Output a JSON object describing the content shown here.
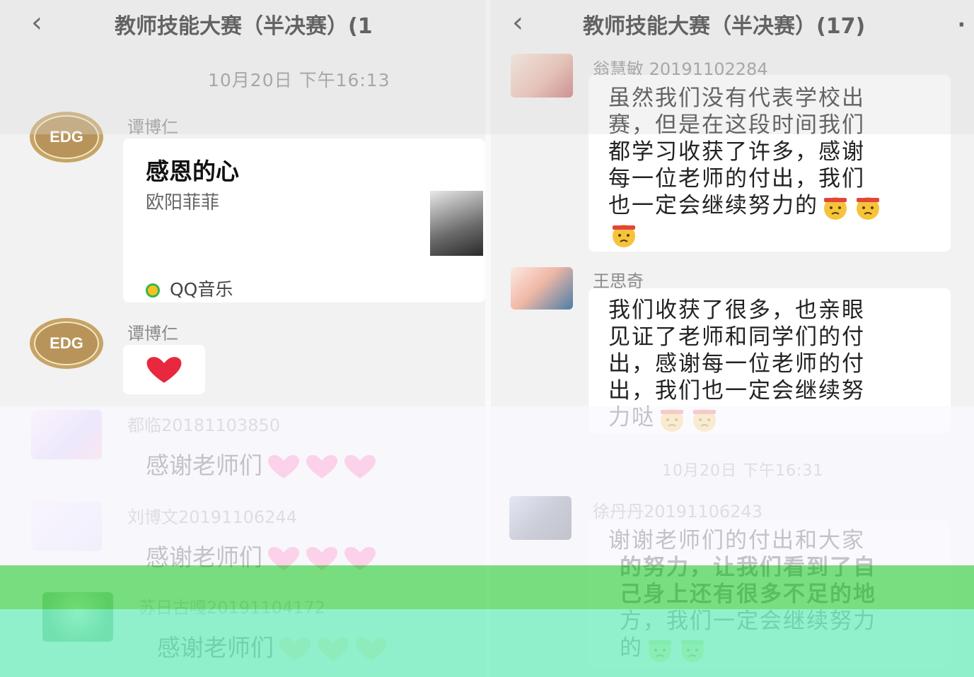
{
  "left_panel": {
    "header": {
      "back_icon": "‹",
      "title": "教师技能大赛（半决赛）(1"
    },
    "timestamp": "10月20日 下午16:13",
    "messages": [
      {
        "sender": "谭博仁",
        "avatar_text": "EDG",
        "music_card": {
          "title": "感恩的心",
          "artist": "欧阳菲菲",
          "source": "QQ音乐"
        }
      },
      {
        "sender": "谭博仁",
        "avatar_text": "EDG",
        "content": "red-heart"
      },
      {
        "sender": "都临20181103850",
        "text": "感谢老师们",
        "hearts": 3
      },
      {
        "sender": "刘博文20191106244",
        "text": "感谢老师们",
        "hearts": 3
      },
      {
        "sender": "苏日古嘎20191104172",
        "text": "感谢老师们",
        "hearts": 3
      }
    ]
  },
  "right_panel": {
    "header": {
      "back_icon": "‹",
      "title": "教师技能大赛（半决赛）(17)",
      "more": "·"
    },
    "messages": [
      {
        "sender": "翁慧敏 20191102284",
        "lines": [
          "虽然我们没有代表学校出",
          "赛，但是在这段时间我们",
          "都学习收获了许多，感谢",
          "每一位老师的付出，我们",
          "也一定会继续努力的"
        ]
      },
      {
        "sender": "王思奇",
        "lines": [
          "我们收获了很多，也亲眼",
          "见证了老师和同学们的付",
          "出，感谢每一位老师的付",
          "出，我们也一定会继续努",
          "力哒"
        ]
      },
      {
        "sender": "徐丹丹20191106243",
        "lines": [
          "谢谢老师们的付出和大家",
          "的努力，让我们看到了自",
          "己身上还有很多不足的地",
          "方，我们一定会继续努力",
          "的"
        ]
      }
    ],
    "timestamp": "10月20日 下午16:31"
  },
  "colors": {
    "heart_pink": "#ff5fa8",
    "heart_red": "#e8283e",
    "edg_gold": "#c6a466",
    "bubble": "#ffffff"
  }
}
